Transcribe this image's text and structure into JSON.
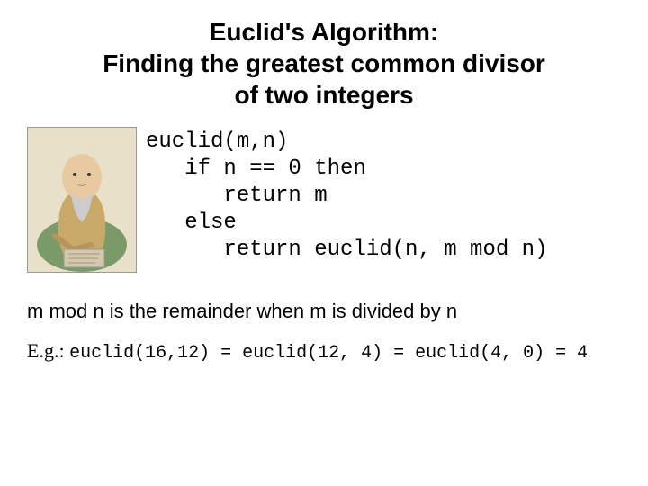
{
  "title": "Euclid's Algorithm:\nFinding the greatest common divisor\nof two integers",
  "code": "euclid(m,n)\n   if n == 0 then\n      return m\n   else\n      return euclid(n, m mod n)",
  "explanation": "m mod n is the remainder when m is divided by n",
  "example_prefix": "E.g.: ",
  "example_code": "euclid(16,12) = euclid(12, 4) = euclid(4, 0) = 4",
  "image_alt": "Portrait of Euclid"
}
